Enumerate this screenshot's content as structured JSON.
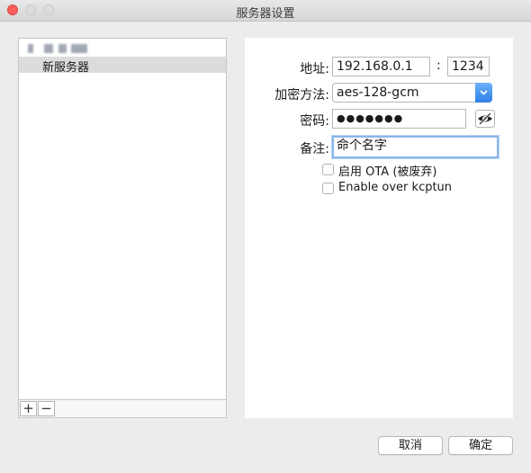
{
  "window": {
    "title": "服务器设置"
  },
  "server_list": {
    "items": [
      {
        "label": ""
      },
      {
        "label": "新服务器",
        "selected": true
      }
    ],
    "add_label": "+",
    "remove_label": "−"
  },
  "form": {
    "address_label": "地址:",
    "address_value": "192.168.0.1",
    "port_separator": ":",
    "port_value": "1234",
    "encryption_label": "加密方法:",
    "encryption_value": "aes-128-gcm",
    "password_label": "密码:",
    "password_value": "●●●●●●●",
    "remark_label": "备注:",
    "remark_value": "命个名字",
    "ota_label": "启用 OTA (被废弃)",
    "ota_checked": false,
    "kcptun_label": "Enable over kcptun",
    "kcptun_checked": false
  },
  "buttons": {
    "cancel": "取消",
    "ok": "确定"
  },
  "colors": {
    "accent": "#2e7fe6",
    "close": "#fc605c"
  },
  "icons": {
    "password_toggle": "eye-slash-icon",
    "select_arrow": "chevron-down-icon"
  }
}
